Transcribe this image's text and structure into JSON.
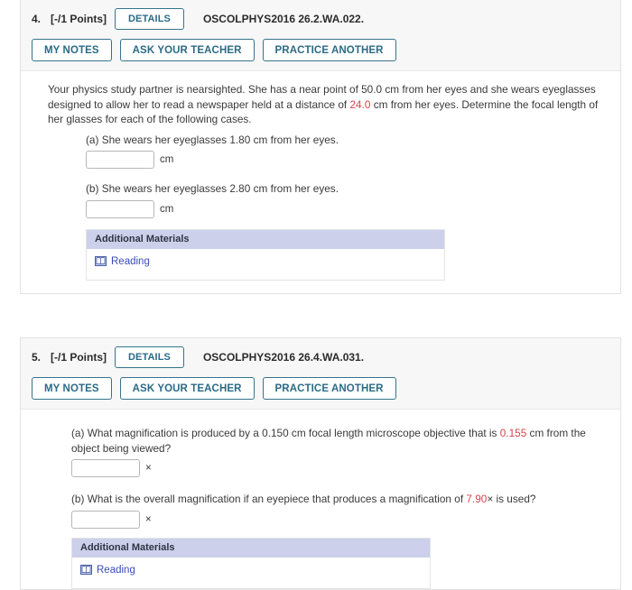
{
  "questions": [
    {
      "number": "4.",
      "points": "[-/1 Points]",
      "details_label": "DETAILS",
      "code": "OSCOLPHYS2016 26.2.WA.022.",
      "actions": [
        {
          "label": "MY NOTES"
        },
        {
          "label": "ASK YOUR TEACHER"
        },
        {
          "label": "PRACTICE ANOTHER"
        }
      ],
      "stem": {
        "seg1": "Your physics study partner is nearsighted. She has a near point of 50.0 cm from her eyes and she wears eyeglasses designed to allow her to read a newspaper held at a distance of ",
        "highlight": "24.0",
        "seg2": " cm from her eyes. Determine the focal length of her glasses for each of the following cases."
      },
      "parts": [
        {
          "text": "(a) She wears her eyeglasses 1.80 cm from her eyes.",
          "value": "",
          "unit": "cm"
        },
        {
          "text": "(b) She wears her eyeglasses 2.80 cm from her eyes.",
          "value": "",
          "unit": "cm"
        }
      ],
      "materials": {
        "header": "Additional Materials",
        "link_label": "Reading",
        "icon": "book-icon"
      }
    },
    {
      "number": "5.",
      "points": "[-/1 Points]",
      "details_label": "DETAILS",
      "code": "OSCOLPHYS2016 26.4.WA.031.",
      "actions": [
        {
          "label": "MY NOTES"
        },
        {
          "label": "ASK YOUR TEACHER"
        },
        {
          "label": "PRACTICE ANOTHER"
        }
      ],
      "parts": [
        {
          "seg1": "(a) What magnification is produced by a 0.150 cm focal length microscope objective that is ",
          "highlight": "0.155",
          "seg2": " cm from the object being viewed?",
          "value": "",
          "unit": "×"
        },
        {
          "seg1": "(b) What is the overall magnification if an eyepiece that produces a magnification of ",
          "highlight": "7.90",
          "seg2": "× is used?",
          "value": "",
          "unit": "×"
        }
      ],
      "materials": {
        "header": "Additional Materials",
        "link_label": "Reading",
        "icon": "book-icon"
      }
    }
  ],
  "colors": {
    "accent_border": "#35748c",
    "accent_text": "#2b6b85",
    "highlight": "#d9434a",
    "materials_header_bg": "#ccd0ea",
    "link": "#3b4cb8",
    "header_bg": "#f7f7f7"
  }
}
